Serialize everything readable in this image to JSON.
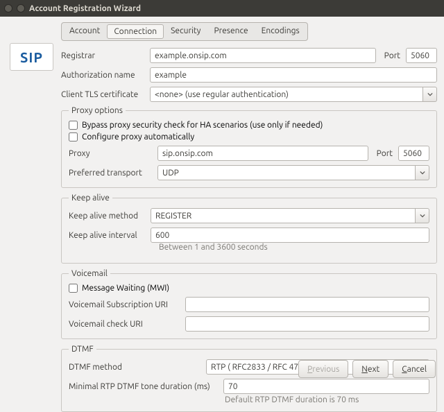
{
  "window": {
    "title": "Account Registration Wizard"
  },
  "sip_logo": "SIP",
  "tabs": {
    "account": "Account",
    "connection": "Connection",
    "security": "Security",
    "presence": "Presence",
    "encodings": "Encodings"
  },
  "labels": {
    "registrar": "Registrar",
    "port": "Port",
    "auth": "Authorization name",
    "tls": "Client TLS certificate",
    "proxy_legend": "Proxy options",
    "bypass": "Bypass proxy security check for HA scenarios (use only if needed)",
    "autoconf": "Configure proxy automatically",
    "proxy": "Proxy",
    "preferred": "Preferred transport",
    "keepalive_legend": "Keep alive",
    "ka_method": "Keep alive method",
    "ka_interval": "Keep alive interval",
    "ka_hint": "Between 1 and 3600 seconds",
    "voicemail_legend": "Voicemail",
    "mwi": "Message Waiting (MWI)",
    "vm_sub": "Voicemail Subscription URI",
    "vm_chk": "Voicemail check URI",
    "dtmf_legend": "DTMF",
    "dtmf_method": "DTMF method",
    "min_rtp": "Minimal RTP DTMF tone duration (ms)",
    "dtmf_hint": "Default RTP DTMF duration is 70 ms"
  },
  "values": {
    "registrar": "example.onsip.com",
    "reg_port": "5060",
    "auth": "example",
    "tls": "<none> (use regular authentication)",
    "proxy": "sip.onsip.com",
    "proxy_port": "5060",
    "preferred": "UDP",
    "ka_method": "REGISTER",
    "ka_interval": "600",
    "vm_sub": "",
    "vm_chk": "",
    "dtmf_method": "RTP ( RFC2833 / RFC 4733 )",
    "min_rtp": "70"
  },
  "buttons": {
    "previous": "Previous",
    "next": "Next",
    "cancel": "Cancel"
  }
}
